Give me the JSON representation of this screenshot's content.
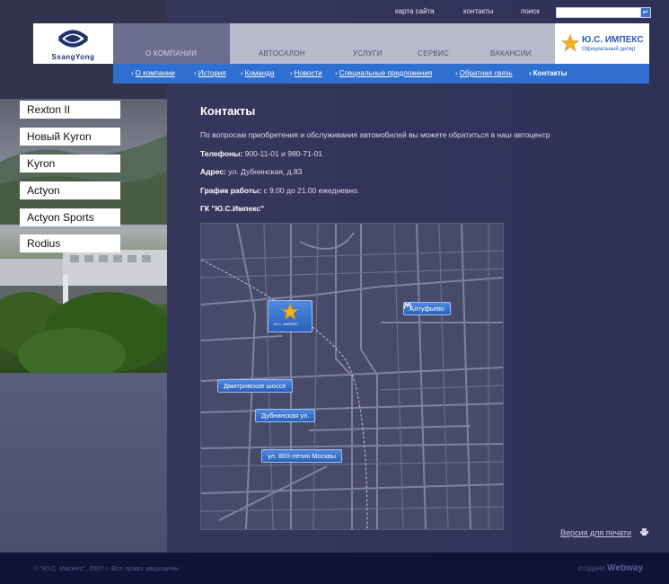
{
  "util_links": {
    "sitemap": "карта сайта",
    "contacts": "контакты",
    "search": "поиск"
  },
  "search": {
    "go_symbol": "↵"
  },
  "logo": {
    "brand": "SsangYong"
  },
  "nav": {
    "about": "О КОМПАНИИ",
    "salon": "АВТОСАЛОН",
    "services": "УСЛУГИ",
    "service": "СЕРВИС",
    "jobs": "ВАКАНСИИ"
  },
  "partner": {
    "name": "Ю.С. ИМПЕКС",
    "subtitle": "Официальный дилер"
  },
  "subnav": [
    "О компании",
    "История",
    "Команда",
    "Новости",
    "Специальные предложения",
    "Обратная связь",
    "Контакты"
  ],
  "models": [
    "Rexton II",
    "Новый Kyron",
    "Kyron",
    "Actyon",
    "Actyon Sports",
    "Rodius"
  ],
  "content": {
    "title": "Контакты",
    "intro": "По вопросам приобретения и обслуживания автомобилей вы можете обратиться в наш автоцентр",
    "phones_label": "Телефоны:",
    "phones_value": " 900-11-01 и 980-71-01",
    "address_label": "Адрес:",
    "address_value": " ул. Дубнинская, д.83",
    "hours_label": "График работы:",
    "hours_value": " с 9.00 до 21.00 ежедневно.",
    "company": "ГК \"Ю.С.Импекс\""
  },
  "map": {
    "office_label": "Ю.С. ИМПЕКС",
    "metro": "Алтуфьево",
    "street_1": "Дмитровское шоссе",
    "street_2": "Дубнинская ул.",
    "street_3": "ул. 800-летия Москвы"
  },
  "print": {
    "label": "Версия для печати"
  },
  "footer": {
    "copyright": "© \"Ю.С. Импекс\", 2007 г. Все права защищены",
    "made_by_prefix": "создано",
    "made_by_brand": "Webway"
  },
  "colors": {
    "accent": "#2f6fd0",
    "background": "#2f3152",
    "footer": "#111237"
  }
}
